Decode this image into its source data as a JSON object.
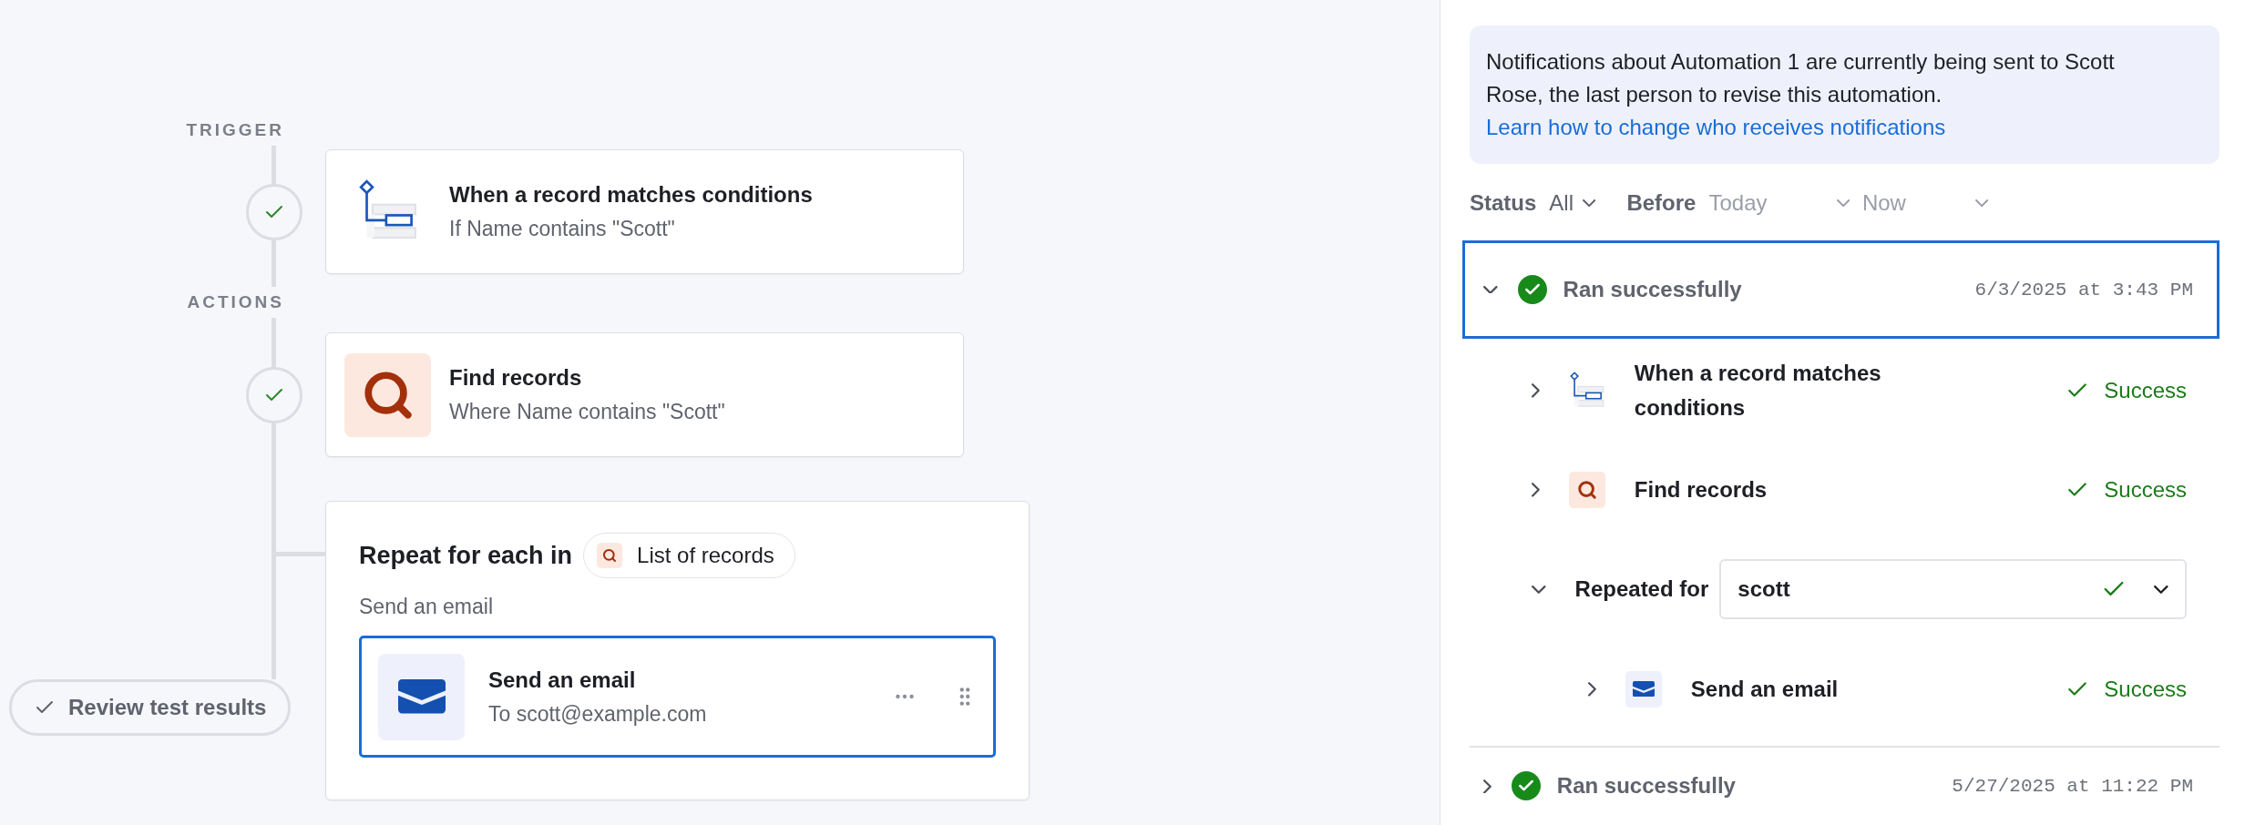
{
  "flow": {
    "sections": [
      {
        "label": "TRIGGER",
        "steps": [
          {
            "kind": "trigger",
            "done": true,
            "title": "When a record matches conditions",
            "description": "If Name contains \"Scott\""
          }
        ]
      },
      {
        "label": "ACTIONS",
        "steps": [
          {
            "kind": "find",
            "done": true,
            "title": "Find records",
            "description": "Where Name contains \"Scott\""
          },
          {
            "kind": "loop",
            "title": "Repeat for each in",
            "chip": "List of records",
            "caption": "Send an email",
            "children": [
              {
                "kind": "email",
                "title": "Send an email",
                "description": "To scott@example.com",
                "selected": true
              }
            ]
          }
        ]
      }
    ],
    "review_button": "Review test results"
  },
  "panel": {
    "notice": {
      "text": "Notifications about Automation 1 are currently being sent to Scott Rose, the last person to revise this automation.",
      "link": "Learn how to change who receives notifications"
    },
    "filters": [
      {
        "label": "Status",
        "dropdowns": [
          {
            "value": "All"
          }
        ]
      },
      {
        "label": "Before",
        "dropdowns": [
          {
            "placeholder": "Today"
          },
          {
            "placeholder": "Now"
          }
        ]
      }
    ],
    "runs": [
      {
        "status": "Ran successfully",
        "time": "6/3/2025 at 3:43 PM",
        "expanded": true,
        "selected": true,
        "steps": [
          {
            "kind": "trigger",
            "title": "When a record matches conditions",
            "result": "Success",
            "expanded": false
          },
          {
            "kind": "find",
            "title": "Find records",
            "result": "Success",
            "expanded": false
          },
          {
            "kind": "loop",
            "label": "Repeated for",
            "value": "scott",
            "expanded": true,
            "children": [
              {
                "kind": "email",
                "title": "Send an email",
                "result": "Success",
                "expanded": false
              }
            ]
          }
        ]
      },
      {
        "status": "Ran successfully",
        "time": "5/27/2025 at 11:22 PM",
        "expanded": false,
        "selected": false
      }
    ]
  }
}
